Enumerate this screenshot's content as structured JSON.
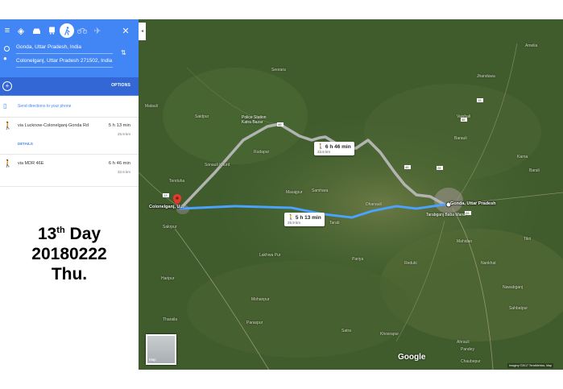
{
  "modes": [
    {
      "icon": "menu-icon",
      "glyph": "≡"
    },
    {
      "icon": "directions-icon",
      "glyph": "◈"
    },
    {
      "icon": "car-icon",
      "glyph": "🚗"
    },
    {
      "icon": "transit-icon",
      "glyph": "🚆"
    },
    {
      "icon": "walk-icon",
      "glyph": "🚶",
      "active": true
    },
    {
      "icon": "bike-icon",
      "glyph": "🚲"
    },
    {
      "icon": "flight-icon",
      "glyph": "✈"
    },
    {
      "icon": "close-icon",
      "glyph": "✕"
    }
  ],
  "origin": "Gonda, Uttar Pradesh, India",
  "destination": "Colonelganj, Uttar Pradesh 271502, India",
  "options_label": "OPTIONS",
  "send_label": "Send directions to your phone",
  "routes": [
    {
      "via": "via Lucknow-Colonelganj-Gonda Rd",
      "time": "5 h 13 min",
      "dist": "25.9 km",
      "details": "DETAILS"
    },
    {
      "via": "via MDR 46E",
      "time": "6 h 46 min",
      "dist": "33.6 km"
    }
  ],
  "caption": {
    "line1": "13",
    "sup": "th",
    "line1b": " Day",
    "line2": "20180222",
    "line3": "Thu."
  },
  "map": {
    "callout_long": {
      "time": "6 h 46 min",
      "dist": "33.6 km"
    },
    "callout_short": {
      "time": "5 h 13 min",
      "dist": "25.9 km"
    },
    "origin_city": "Gonda, Uttar Pradesh",
    "dest_city": "Colonelganj, U...",
    "labels": [
      "Police Station Katra Bazar",
      "Paraspur",
      "Malauli",
      "Mahidan",
      "Rudapur",
      "Seorara",
      "Mohanpur",
      "Saidpur",
      "Sakrpur",
      "Tenduha",
      "Sonauli Khurd",
      "Samhara",
      "Masajpur",
      "Tarabganj Baba Mana",
      "Vaishali",
      "Dhanauli",
      "Tarab",
      "Jhanduwa",
      "Barauli",
      "Pariya",
      "Satra",
      "Lakhwa Pur",
      "Haripur",
      "Khosrapur",
      "Nawabganj",
      "Chaubepur",
      "Nankhat",
      "Ahrauli",
      "Pandey",
      "Sahbatpur",
      "Karna",
      "Amelia",
      "Barali",
      "Tikri",
      "Reduki",
      "Tharaila"
    ],
    "route_signs": [
      "46",
      "15",
      "13",
      "28",
      "46",
      "28",
      "46"
    ],
    "attribution": "Imagery ©2017 TerraMetrics, Map",
    "google": "Google",
    "thumb_label": "Map"
  }
}
